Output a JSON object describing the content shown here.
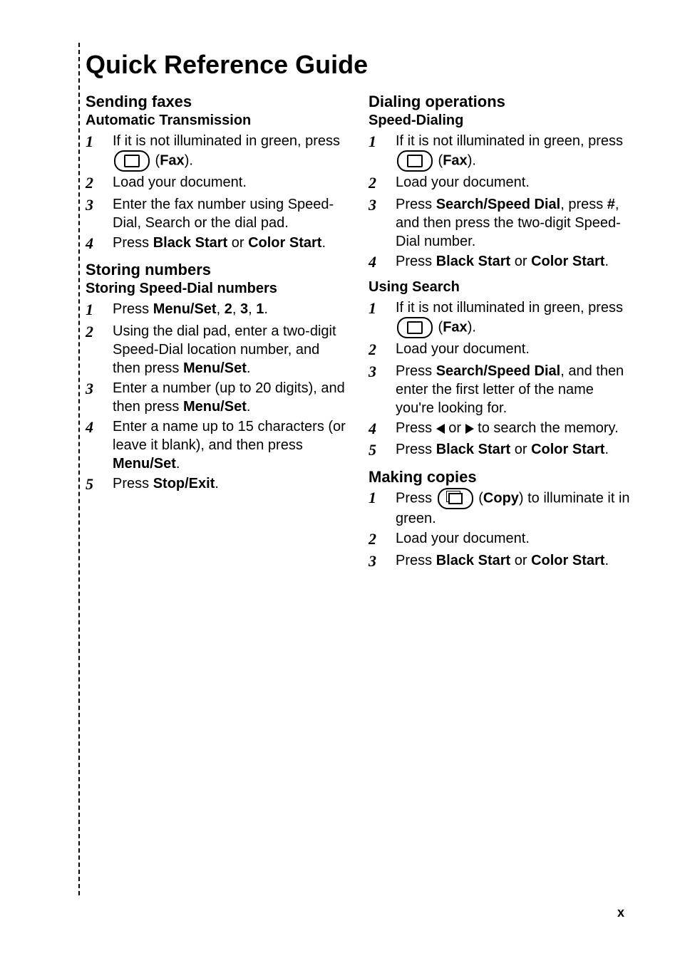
{
  "page_title": "Quick Reference Guide",
  "page_number": "x",
  "left": {
    "sending_faxes": {
      "title": "Sending faxes",
      "auto": {
        "title": "Automatic Transmission",
        "steps": {
          "s1a": "If it is not illuminated in green, press ",
          "s1b": " (",
          "s1c": "Fax",
          "s1d": ").",
          "s2": "Load your document.",
          "s3": "Enter the fax number using Speed-Dial, Search or the dial pad.",
          "s4a": "Press ",
          "s4b": "Black Start",
          "s4c": " or ",
          "s4d": "Color Start",
          "s4e": "."
        }
      }
    },
    "storing_numbers": {
      "title": "Storing numbers",
      "speed": {
        "title": "Storing Speed-Dial numbers",
        "steps": {
          "s1a": "Press ",
          "s1b": "Menu/Set",
          "s1c": ", ",
          "s1d": "2",
          "s1e": ", ",
          "s1f": "3",
          "s1g": ", ",
          "s1h": "1",
          "s1i": ".",
          "s2a": "Using the dial pad, enter a two-digit Speed-Dial location number, and then press ",
          "s2b": "Menu/Set",
          "s2c": ".",
          "s3a": "Enter a number (up to 20 digits), and then press ",
          "s3b": "Menu/Set",
          "s3c": ".",
          "s4a": "Enter a name up to 15 characters (or leave it blank), and then press ",
          "s4b": "Menu/Set",
          "s4c": ".",
          "s5a": "Press ",
          "s5b": "Stop/Exit",
          "s5c": "."
        }
      }
    }
  },
  "right": {
    "dialing": {
      "title": "Dialing operations",
      "speed": {
        "title": "Speed-Dialing",
        "steps": {
          "s1a": "If it is not illuminated in green, press ",
          "s1b": " (",
          "s1c": "Fax",
          "s1d": ").",
          "s2": "Load your document.",
          "s3a": "Press ",
          "s3b": "Search/Speed Dial",
          "s3c": ", press ",
          "s3d": "#",
          "s3e": ", and then press the two-digit Speed-Dial number.",
          "s4a": "Press ",
          "s4b": "Black Start",
          "s4c": " or ",
          "s4d": "Color Start",
          "s4e": "."
        }
      },
      "search": {
        "title": "Using Search",
        "steps": {
          "s1a": "If it is not illuminated in green, press ",
          "s1b": " (",
          "s1c": "Fax",
          "s1d": ").",
          "s2": "Load your document.",
          "s3a": "Press ",
          "s3b": "Search/Speed Dial",
          "s3c": ", and then enter the first letter of the name you're looking for.",
          "s4a": "Press ",
          "s4b": " or ",
          "s4c": " to search the memory.",
          "s5a": "Press ",
          "s5b": "Black Start",
          "s5c": " or ",
          "s5d": "Color Start",
          "s5e": "."
        }
      }
    },
    "copies": {
      "title": "Making copies",
      "steps": {
        "s1a": "Press ",
        "s1b": " (",
        "s1c": "Copy",
        "s1d": ") to illuminate it in green.",
        "s2": "Load your document.",
        "s3a": "Press ",
        "s3b": "Black Start",
        "s3c": " or ",
        "s3d": "Color Start",
        "s3e": "."
      }
    }
  }
}
